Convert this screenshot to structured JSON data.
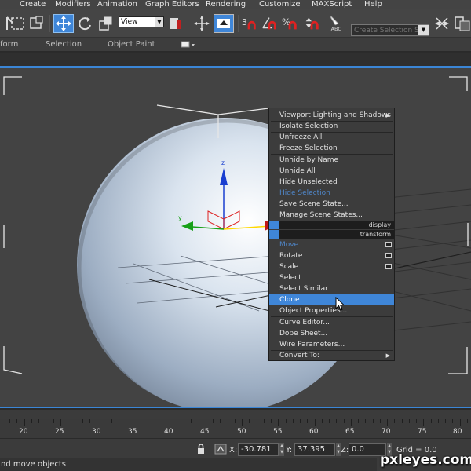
{
  "menubar": {
    "items": [
      "Create",
      "Modifiers",
      "Animation",
      "Graph Editors",
      "Rendering",
      "Customize",
      "MAXScript",
      "Help"
    ]
  },
  "toolbar": {
    "view_dropdown": "View",
    "selection_set_placeholder": "Create Selection Se",
    "icons": [
      "select-region-icon",
      "window-crossing-icon",
      "select-move-icon",
      "select-rotate-icon",
      "select-scale-icon",
      "pivot-center-icon",
      "select-manipulate-icon",
      "snap-toggle-icon",
      "angle-snap-icon",
      "percent-snap-icon",
      "spinner-snap-icon",
      "edit-named-selection-icon"
    ],
    "snap_labels": {
      "snap": "3",
      "percent": "%",
      "abc": "ABC"
    }
  },
  "ribbon": {
    "tabs": [
      "form",
      "Selection",
      "Object Paint"
    ]
  },
  "axis": {
    "x": "x",
    "y": "y",
    "z": "z"
  },
  "quad_menu": {
    "items": [
      {
        "label": "Viewport Lighting and Shadows",
        "arrow": true
      },
      {
        "label": "Isolate Selection"
      },
      {
        "label": "Unfreeze All"
      },
      {
        "label": "Freeze Selection"
      },
      {
        "label": "Unhide by Name"
      },
      {
        "label": "Unhide All"
      },
      {
        "label": "Hide Unselected"
      },
      {
        "label": "Hide Selection",
        "disabled": true
      },
      {
        "label": "Save Scene State..."
      },
      {
        "label": "Manage Scene States..."
      }
    ],
    "headers": {
      "display": "display",
      "transform": "transform"
    },
    "transform_items": [
      {
        "label": "Move",
        "disabled": true,
        "box": true
      },
      {
        "label": "Rotate",
        "box": true
      },
      {
        "label": "Scale",
        "box": true
      },
      {
        "label": "Select"
      },
      {
        "label": "Select Similar"
      },
      {
        "label": "Clone",
        "highlighted": true
      },
      {
        "label": "Object Properties..."
      },
      {
        "label": "Curve Editor..."
      },
      {
        "label": "Dope Sheet..."
      },
      {
        "label": "Wire Parameters..."
      },
      {
        "label": "Convert To:",
        "arrow": true
      }
    ]
  },
  "trackbar": {
    "ticks": [
      "20",
      "25",
      "30",
      "35",
      "40",
      "45",
      "50",
      "55",
      "60",
      "65",
      "70",
      "75",
      "80"
    ]
  },
  "status": {
    "x_label": "X:",
    "x_value": "-30.781",
    "y_label": "Y:",
    "y_value": "37.395",
    "z_label": "Z:",
    "z_value": "0.0",
    "grid": "Grid = 0.0",
    "prompt": "nd move objects"
  },
  "watermark": "pxleyes.com",
  "colors": {
    "highlight": "#3f86d8",
    "viewport_border": "#3b86d6",
    "sphere": "#c3d0de",
    "axis_z": "#1a3fd0",
    "axis_x": "#c01818",
    "axis_y": "#18a018"
  }
}
